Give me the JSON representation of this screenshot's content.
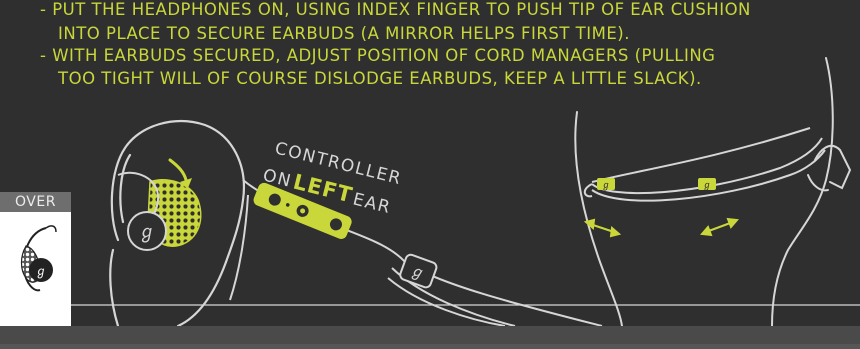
{
  "instructions": {
    "line1": "- PUT THE HEADPHONES ON, USING INDEX FINGER TO PUSH TIP OF EAR CUSHION",
    "line2": "INTO PLACE TO SECURE EARBUDS (A MIRROR HELPS FIRST TIME).",
    "line3": "- WITH EARBUDS SECURED, ADJUST POSITION OF CORD MANAGERS (PULLING",
    "line4": "TOO TIGHT WILL OF COURSE DISLODGE EARBUDS, KEEP A LITTLE SLACK)."
  },
  "callout": {
    "controller": "CONTROLLER",
    "on": "ON",
    "left": "LEFT",
    "ear": "EAR"
  },
  "over_tab": {
    "label": "OVER"
  },
  "colors": {
    "background": "#2f2f2f",
    "accent": "#c9d73a",
    "line_art": "#d6d6d6",
    "tab": "#6e6e6e"
  },
  "icons": [
    "ear-illustration",
    "earbud-icon",
    "controller-icon",
    "jaybird-logo-icon",
    "cord-manager-icon",
    "adjust-arrow-icon",
    "head-profile-illustration"
  ]
}
